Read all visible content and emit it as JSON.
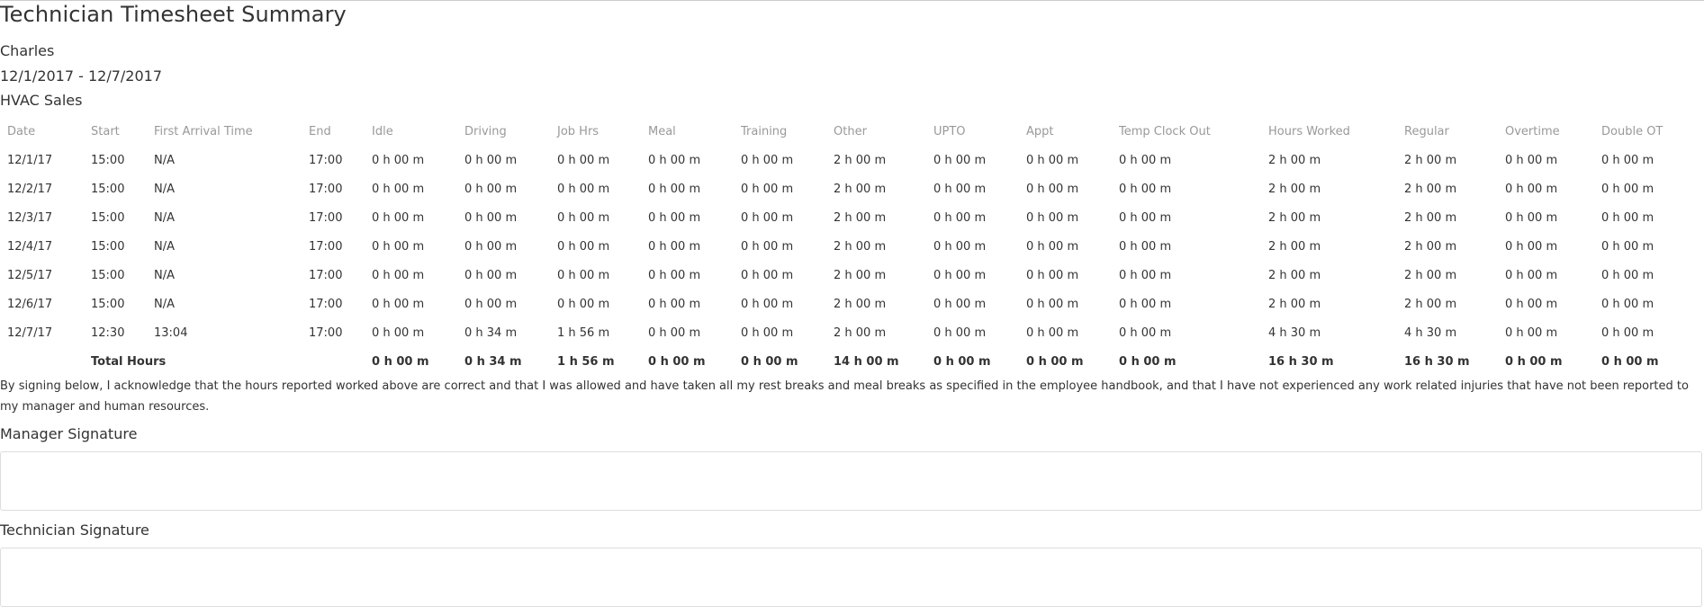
{
  "report": {
    "title": "Technician Timesheet Summary",
    "technician_name": "Charles",
    "date_range": "12/1/2017 - 12/7/2017",
    "department": "HVAC Sales"
  },
  "table": {
    "headers": [
      "Date",
      "Start",
      "First Arrival Time",
      "End",
      "Idle",
      "Driving",
      "Job Hrs",
      "Meal",
      "Training",
      "Other",
      "UPTO",
      "Appt",
      "Temp Clock Out",
      "Hours Worked",
      "Regular",
      "Overtime",
      "Double OT"
    ],
    "rows": [
      [
        "12/1/17",
        "15:00",
        "N/A",
        "17:00",
        "0 h 00 m",
        "0 h 00 m",
        "0 h 00 m",
        "0 h 00 m",
        "0 h 00 m",
        "2 h 00 m",
        "0 h 00 m",
        "0 h 00 m",
        "0 h 00 m",
        "2 h 00 m",
        "2 h 00 m",
        "0 h 00 m",
        "0 h 00 m"
      ],
      [
        "12/2/17",
        "15:00",
        "N/A",
        "17:00",
        "0 h 00 m",
        "0 h 00 m",
        "0 h 00 m",
        "0 h 00 m",
        "0 h 00 m",
        "2 h 00 m",
        "0 h 00 m",
        "0 h 00 m",
        "0 h 00 m",
        "2 h 00 m",
        "2 h 00 m",
        "0 h 00 m",
        "0 h 00 m"
      ],
      [
        "12/3/17",
        "15:00",
        "N/A",
        "17:00",
        "0 h 00 m",
        "0 h 00 m",
        "0 h 00 m",
        "0 h 00 m",
        "0 h 00 m",
        "2 h 00 m",
        "0 h 00 m",
        "0 h 00 m",
        "0 h 00 m",
        "2 h 00 m",
        "2 h 00 m",
        "0 h 00 m",
        "0 h 00 m"
      ],
      [
        "12/4/17",
        "15:00",
        "N/A",
        "17:00",
        "0 h 00 m",
        "0 h 00 m",
        "0 h 00 m",
        "0 h 00 m",
        "0 h 00 m",
        "2 h 00 m",
        "0 h 00 m",
        "0 h 00 m",
        "0 h 00 m",
        "2 h 00 m",
        "2 h 00 m",
        "0 h 00 m",
        "0 h 00 m"
      ],
      [
        "12/5/17",
        "15:00",
        "N/A",
        "17:00",
        "0 h 00 m",
        "0 h 00 m",
        "0 h 00 m",
        "0 h 00 m",
        "0 h 00 m",
        "2 h 00 m",
        "0 h 00 m",
        "0 h 00 m",
        "0 h 00 m",
        "2 h 00 m",
        "2 h 00 m",
        "0 h 00 m",
        "0 h 00 m"
      ],
      [
        "12/6/17",
        "15:00",
        "N/A",
        "17:00",
        "0 h 00 m",
        "0 h 00 m",
        "0 h 00 m",
        "0 h 00 m",
        "0 h 00 m",
        "2 h 00 m",
        "0 h 00 m",
        "0 h 00 m",
        "0 h 00 m",
        "2 h 00 m",
        "2 h 00 m",
        "0 h 00 m",
        "0 h 00 m"
      ],
      [
        "12/7/17",
        "12:30",
        "13:04",
        "17:00",
        "0 h 00 m",
        "0 h 34 m",
        "1 h 56 m",
        "0 h 00 m",
        "0 h 00 m",
        "2 h 00 m",
        "0 h 00 m",
        "0 h 00 m",
        "0 h 00 m",
        "4 h 30 m",
        "4 h 30 m",
        "0 h 00 m",
        "0 h 00 m"
      ]
    ],
    "totals": [
      "",
      "Total Hours",
      "",
      "",
      "0 h 00 m",
      "0 h 34 m",
      "1 h 56 m",
      "0 h 00 m",
      "0 h 00 m",
      "14 h 00 m",
      "0 h 00 m",
      "0 h 00 m",
      "0 h 00 m",
      "16 h 30 m",
      "16 h 30 m",
      "0 h 00 m",
      "0 h 00 m"
    ]
  },
  "acknowledgement": "By signing below, I acknowledge that the hours reported worked above are correct and that I was allowed and have taken all my rest breaks and meal breaks as specified in the employee handbook, and that I have not experienced any work related injuries that have not been reported to my manager and human resources.",
  "signatures": {
    "manager_label": "Manager Signature",
    "technician_label": "Technician Signature"
  }
}
